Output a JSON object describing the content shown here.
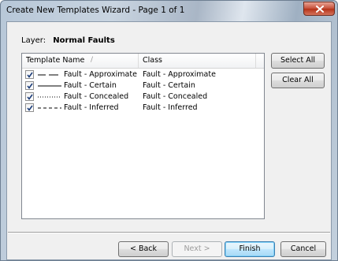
{
  "window": {
    "title": "Create New Templates Wizard - Page 1 of 1"
  },
  "layer": {
    "label": "Layer:",
    "name": "Normal Faults"
  },
  "list": {
    "columns": [
      "Template Name",
      "Class"
    ],
    "sort_indicator": "/",
    "rows": [
      {
        "name": "Fault - Approximate",
        "class": "Fault - Approximate",
        "checked": true,
        "symbol": "dashed-line"
      },
      {
        "name": "Fault - Certain",
        "class": "Fault - Certain",
        "checked": true,
        "symbol": "solid-line"
      },
      {
        "name": "Fault - Concealed",
        "class": "Fault - Concealed",
        "checked": true,
        "symbol": "dotted-line"
      },
      {
        "name": "Fault - Inferred",
        "class": "Fault - Inferred",
        "checked": true,
        "symbol": "short-dash-line"
      }
    ]
  },
  "side_buttons": {
    "select_all": "Select All",
    "clear_all": "Clear All"
  },
  "footer_buttons": {
    "back": "< Back",
    "next": "Next >",
    "finish": "Finish",
    "cancel": "Cancel"
  },
  "icons": {
    "close": "close-icon",
    "checkbox": "check-icon"
  },
  "colors": {
    "close_button": "#c7513b",
    "default_button_border": "#3c7fb1"
  }
}
